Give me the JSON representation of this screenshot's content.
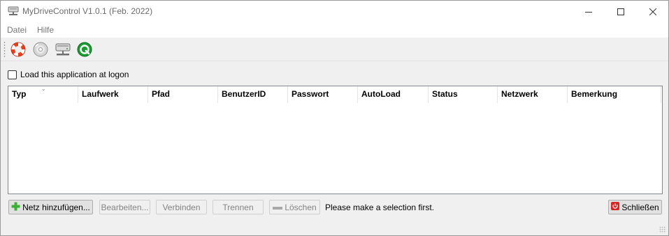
{
  "window": {
    "title": "MyDriveControl V1.0.1 (Feb. 2022)",
    "minimize_glyph": "—",
    "maximize_glyph": "☐",
    "close_glyph": "✕"
  },
  "menu": {
    "items": [
      {
        "label": "Datei"
      },
      {
        "label": "Hilfe"
      }
    ]
  },
  "toolbar": {
    "buttons": [
      {
        "icon": "lifebuoy-icon"
      },
      {
        "icon": "disc-icon"
      },
      {
        "icon": "network-drive-icon"
      },
      {
        "icon": "quit-icon"
      }
    ]
  },
  "logon": {
    "label": "Load this application at logon",
    "checked": false
  },
  "table": {
    "columns": [
      "Typ",
      "Laufwerk",
      "Pfad",
      "BenutzerID",
      "Passwort",
      "AutoLoad",
      "Status",
      "Netzwerk",
      "Bemerkung"
    ],
    "sort_glyph": "⌄",
    "rows": []
  },
  "buttons": {
    "add": "Netz hinzufügen...",
    "edit": "Bearbeiten...",
    "connect": "Verbinden",
    "disconnect": "Trennen",
    "delete": "Löschen",
    "close": "Schließen"
  },
  "status": {
    "message": "Please make a selection first."
  },
  "colors": {
    "add_icon": "#3cb034",
    "close_icon": "#d42828",
    "quit_icon": "#1a9c32"
  }
}
